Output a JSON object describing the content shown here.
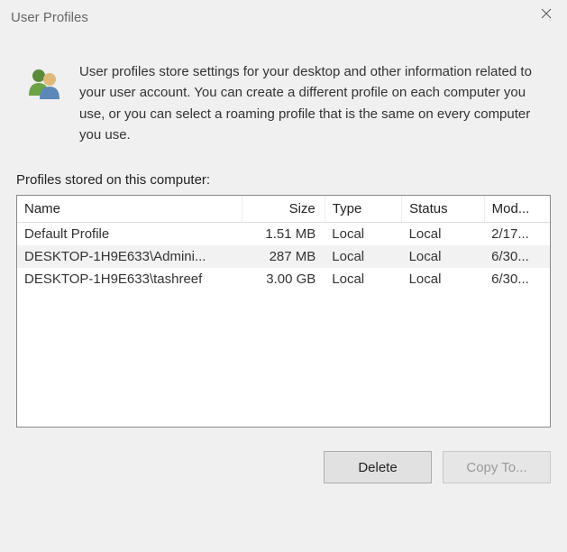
{
  "titlebar": {
    "title": "User Profiles"
  },
  "info": {
    "text": "User profiles store settings for your desktop and other information related to your user account. You can create a different profile on each computer you use, or you can select a roaming profile that is the same on every computer you use."
  },
  "section_label": "Profiles stored on this computer:",
  "table": {
    "headers": {
      "name": "Name",
      "size": "Size",
      "type": "Type",
      "status": "Status",
      "modified": "Mod..."
    },
    "rows": [
      {
        "name": "Default Profile",
        "size": "1.51 MB",
        "type": "Local",
        "status": "Local",
        "modified": "2/17...",
        "selected": false
      },
      {
        "name": "DESKTOP-1H9E633\\Admini...",
        "size": "287 MB",
        "type": "Local",
        "status": "Local",
        "modified": "6/30...",
        "selected": true
      },
      {
        "name": "DESKTOP-1H9E633\\tashreef",
        "size": "3.00 GB",
        "type": "Local",
        "status": "Local",
        "modified": "6/30...",
        "selected": false
      }
    ]
  },
  "buttons": {
    "delete": "Delete",
    "copy_to": "Copy To..."
  }
}
